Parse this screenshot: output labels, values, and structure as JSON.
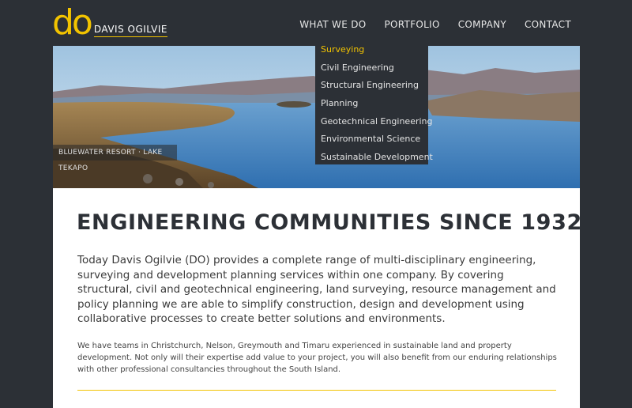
{
  "logo": {
    "mark": "do",
    "text": "DAVIS OGILVIE"
  },
  "nav": [
    {
      "label": "WHAT WE DO"
    },
    {
      "label": "PORTFOLIO"
    },
    {
      "label": "COMPANY"
    },
    {
      "label": "CONTACT"
    }
  ],
  "dropdown": [
    {
      "label": "Surveying"
    },
    {
      "label": "Civil Engineering"
    },
    {
      "label": "Structural Engineering"
    },
    {
      "label": "Planning"
    },
    {
      "label": "Geotechnical Engineering"
    },
    {
      "label": "Environmental Science"
    },
    {
      "label": "Sustainable Development"
    }
  ],
  "hero": {
    "caption": "BLUEWATER RESORT · LAKE TEKAPO"
  },
  "main": {
    "headline": "ENGINEERING COMMUNITIES SINCE 1932",
    "lead": "Today Davis Ogilvie (DO) provides a complete range of multi-disciplinary engineering, surveying and development planning services within one company. By covering structural, civil and geotechnical engineering, land surveying, resource management and policy planning we are able to simplify construction, design and development using collaborative processes to create better solutions and environments.",
    "body": "We have teams in Christchurch, Nelson, Greymouth and Timaru experienced in sustainable land and property development. Not only will their expertise add value to your project, you will also benefit from our enduring relationships with other professional consultancies throughout the South Island."
  },
  "colors": {
    "accent": "#f2c300",
    "background": "#2c3036",
    "panel": "#ffffff"
  }
}
